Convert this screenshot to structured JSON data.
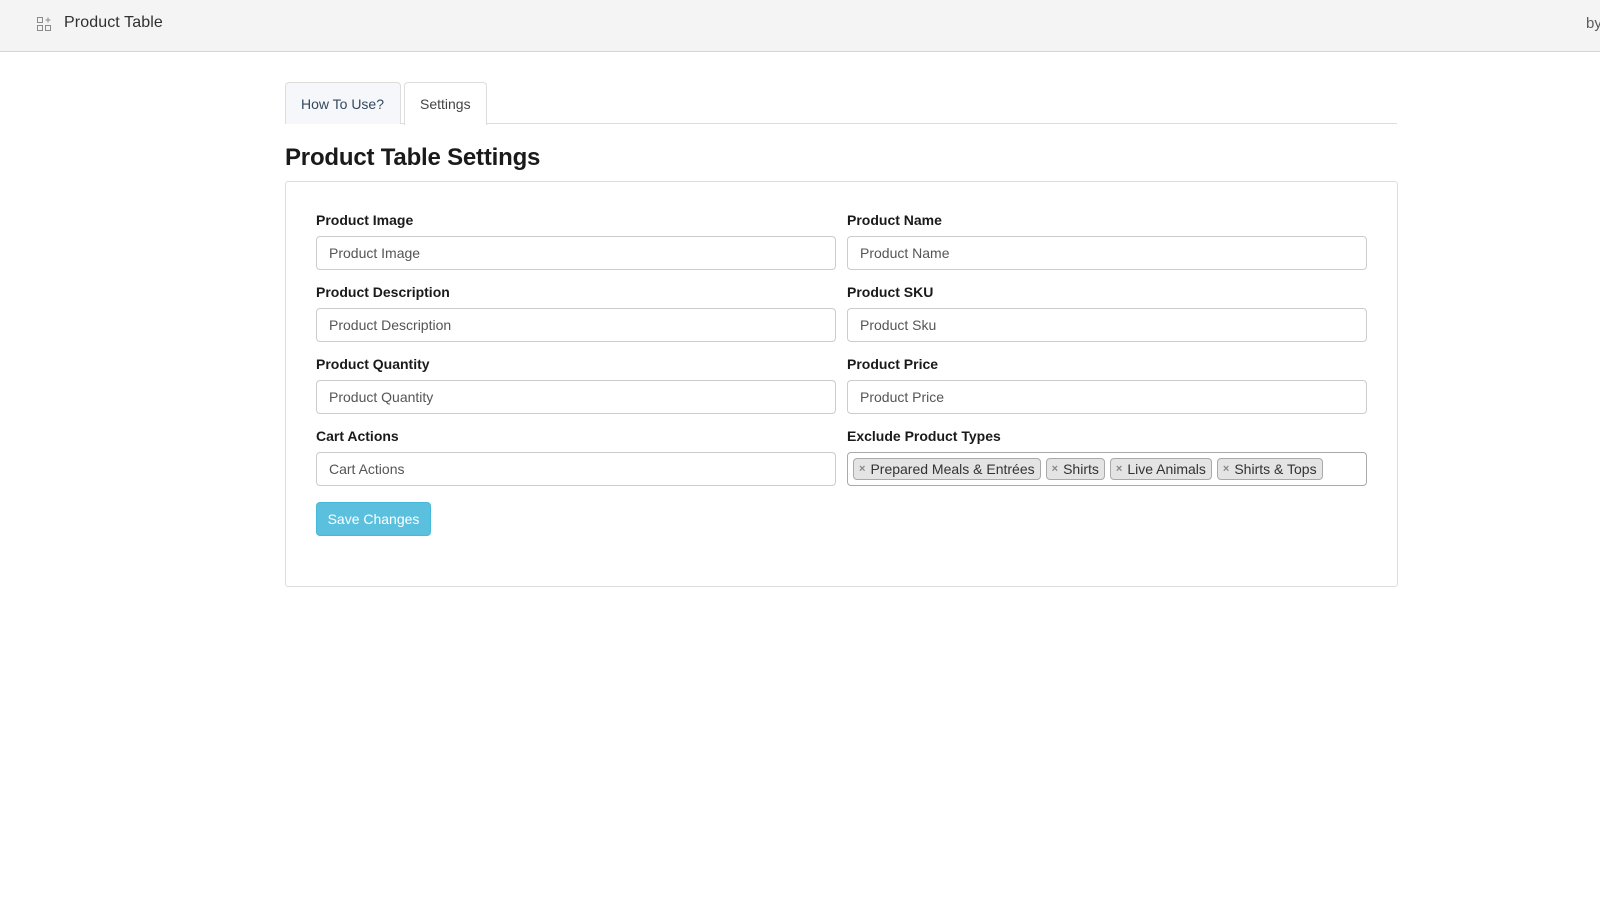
{
  "topbar": {
    "app_icon": "apps-add-icon",
    "title": "Product Table",
    "right_text": "by"
  },
  "tabs": [
    {
      "label": "How To Use?",
      "active": false
    },
    {
      "label": "Settings",
      "active": true
    }
  ],
  "page_title": "Product Table Settings",
  "form": {
    "fields": [
      {
        "label": "Product Image",
        "value": "Product Image"
      },
      {
        "label": "Product Name",
        "value": "Product Name"
      },
      {
        "label": "Product Description",
        "value": "Product Description"
      },
      {
        "label": "Product SKU",
        "value": "Product Sku"
      },
      {
        "label": "Product Quantity",
        "value": "Product Quantity"
      },
      {
        "label": "Product Price",
        "value": "Product Price"
      },
      {
        "label": "Cart Actions",
        "value": "Cart Actions"
      }
    ],
    "exclude": {
      "label": "Exclude Product Types",
      "remove_glyph": "×",
      "tags": [
        "Prepared Meals & Entrées",
        "Shirts",
        "Live Animals",
        "Shirts & Tops"
      ]
    },
    "save_label": "Save Changes"
  },
  "colors": {
    "primary_button": "#5bc0de",
    "topbar_bg": "#f4f4f4"
  }
}
